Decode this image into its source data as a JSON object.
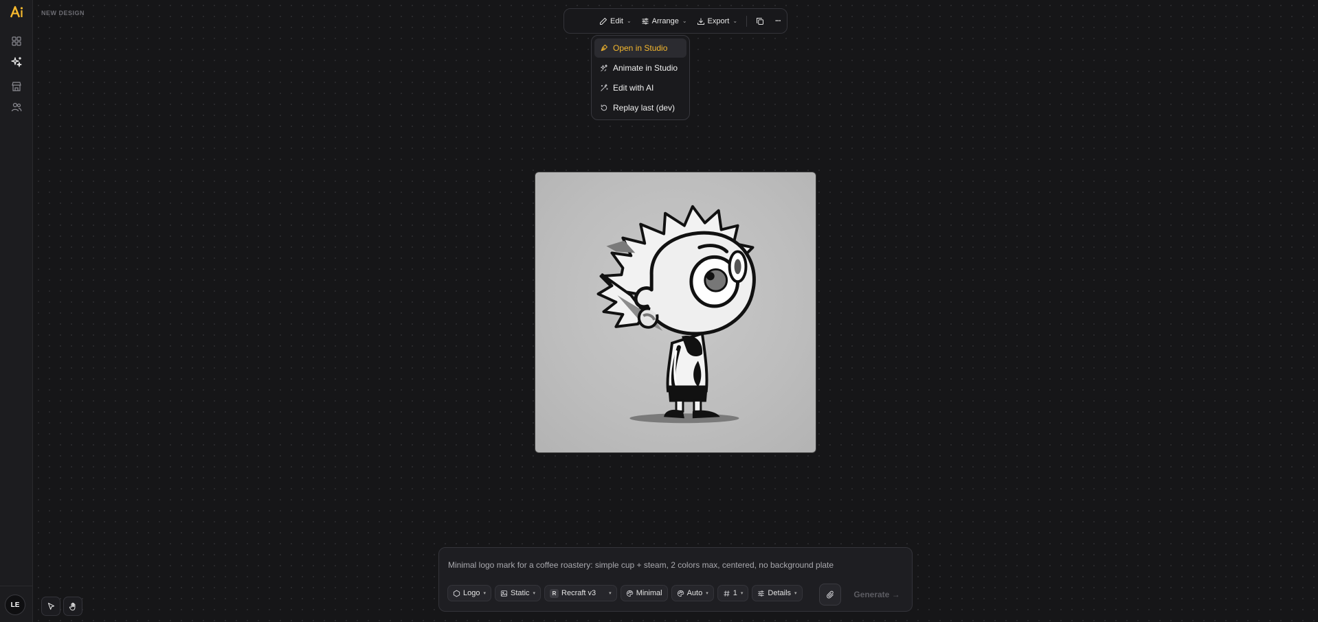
{
  "app": {
    "logo_text": "Ai",
    "design_title": "NEW DESIGN",
    "user_initials": "LE"
  },
  "sidebar": {
    "items": [
      {
        "name": "dashboard",
        "icon": "grid-icon"
      },
      {
        "name": "generate",
        "icon": "sparkles-icon",
        "active": true
      },
      {
        "name": "library",
        "icon": "store-icon"
      },
      {
        "name": "team",
        "icon": "users-icon"
      }
    ]
  },
  "toolbar": {
    "edit_label": "Edit",
    "arrange_label": "Arrange",
    "export_label": "Export",
    "more_label": "···"
  },
  "edit_menu": {
    "items": [
      {
        "label": "Open in Studio",
        "icon": "pen-tool-icon",
        "active": true
      },
      {
        "label": "Animate in Studio",
        "icon": "sparkles-icon"
      },
      {
        "label": "Edit with AI",
        "icon": "magic-wand-icon"
      },
      {
        "label": "Replay last (dev)",
        "icon": "rotate-ccw-icon"
      }
    ]
  },
  "canvas": {
    "image_subject": "cartoon-boy-illustration"
  },
  "prompt": {
    "text": "Minimal logo mark for a coffee roastery: simple cup + steam, 2 colors max, centered, no background plate",
    "chips": {
      "type": "Logo",
      "motion": "Static",
      "model_badge": "R",
      "model": "Recraft v3",
      "style": "Minimal",
      "palette": "Auto",
      "count": "1",
      "details": "Details"
    },
    "generate_label": "Generate →"
  },
  "colors": {
    "accent": "#f5b82e",
    "background": "#141416",
    "panel": "#1e1e22"
  }
}
